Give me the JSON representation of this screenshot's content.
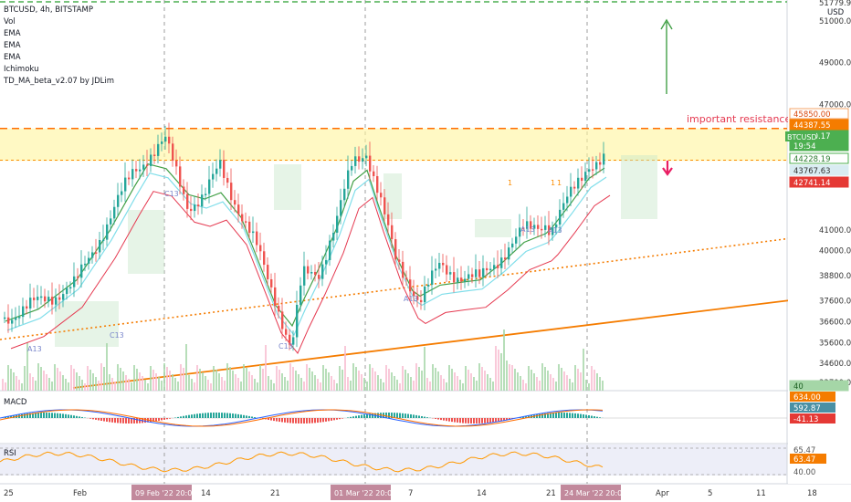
{
  "legend": {
    "title": "BTCUSD, 4h, BITSTAMP",
    "indicators": [
      "Vol",
      "EMA",
      "EMA",
      "EMA",
      "Ichimoku",
      "TD_MA_beta_v2.07 by JDLim"
    ]
  },
  "currency_label": "USD",
  "annotation": "important resistance",
  "symbol_tag": "BTCUSD",
  "macd_label": "MACD",
  "rsi_label": "RSI",
  "price_scale": {
    "ticks": [
      "51000.00",
      "49000.00",
      "47000.00",
      "41000.00",
      "40000.00",
      "38800.00",
      "37600.00",
      "36600.00",
      "35600.00",
      "34600.00",
      "33700.00"
    ],
    "top_partial": "51779.92",
    "badges": [
      {
        "text": "45850.00",
        "bg": "#ffffff",
        "fg": "#d9480f",
        "border": "#f4a46a"
      },
      {
        "text": "44387.55",
        "bg": "#f57c00",
        "fg": "#ffffff",
        "border": "#f57c00"
      },
      {
        "text": "44340.17",
        "bg": "#4caf50",
        "fg": "#ffffff",
        "border": "#4caf50"
      },
      {
        "text": "19:54",
        "bg": "#4caf50",
        "fg": "#ffffff",
        "border": "#4caf50"
      },
      {
        "text": "44228.19",
        "bg": "#ffffff",
        "fg": "#2e7d32",
        "border": "#4caf50"
      },
      {
        "text": "43767.63",
        "bg": "#d9ecf2",
        "fg": "#333333",
        "border": "#d9ecf2"
      },
      {
        "text": "42741.14",
        "bg": "#e53935",
        "fg": "#ffffff",
        "border": "#e53935"
      },
      {
        "text": "40",
        "bg": "#a5d6a7",
        "fg": "#1b5e20",
        "border": "#a5d6a7"
      }
    ],
    "macd_badges": [
      {
        "text": "634.00",
        "bg": "#f57c00",
        "fg": "#ffffff"
      },
      {
        "text": "592.87",
        "bg": "#4a90a4",
        "fg": "#ffffff"
      },
      {
        "text": "-41.13",
        "bg": "#e53935",
        "fg": "#ffffff"
      }
    ],
    "rsi_badges": [
      {
        "text": "65.47",
        "bg": "#ffffff",
        "fg": "#555555"
      },
      {
        "text": "63.47",
        "bg": "#f57c00",
        "fg": "#ffffff"
      },
      {
        "text": "40.00",
        "bg": "#ffffff",
        "fg": "#555555"
      }
    ]
  },
  "time_axis": {
    "labels": [
      "25",
      "Feb",
      "7",
      "14",
      "21",
      "7",
      "14",
      "21",
      "Apr",
      "5",
      "11",
      "18"
    ],
    "highlights": [
      "09 Feb '22  20:00",
      "01 Mar '22  20:00",
      "24 Mar '22  20:00"
    ]
  },
  "markers": {
    "td_labels": [
      "A13",
      "C13",
      "A13",
      "C13",
      "A13",
      "C13",
      "A13"
    ],
    "counts": [
      "1",
      "1",
      "1"
    ]
  },
  "colors": {
    "up": "#26a69a",
    "down": "#ef5350",
    "resistance_band": "#fff59d",
    "resistance_line": "#ff6d00",
    "trend_line": "#f57c00",
    "ema_fast": "#43a047",
    "ema_mid": "#80deea",
    "ema_slow": "#e53950",
    "arrow_up": "#43a047",
    "arrow_down": "#e91e63"
  },
  "chart_data": {
    "type": "candlestick",
    "symbol": "BTCUSD",
    "interval": "4h",
    "exchange": "BITSTAMP",
    "ylim": [
      33300,
      52000
    ],
    "x_dates": [
      "Jan 25",
      "Feb 1",
      "Feb 7",
      "Feb 14",
      "Feb 21",
      "Mar 1",
      "Mar 7",
      "Mar 14",
      "Mar 21",
      "Mar 24",
      "Apr 1",
      "Apr 5",
      "Apr 11",
      "Apr 18"
    ],
    "resistance": 45850,
    "last_price": 44340.17,
    "close_path": [
      {
        "date": "Jan 25",
        "close": 36800
      },
      {
        "date": "Jan 28",
        "close": 37500
      },
      {
        "date": "Feb 1",
        "close": 38400
      },
      {
        "date": "Feb 4",
        "close": 41500
      },
      {
        "date": "Feb 7",
        "close": 43800
      },
      {
        "date": "Feb 9",
        "close": 44500
      },
      {
        "date": "Feb 10",
        "close": 45200
      },
      {
        "date": "Feb 12",
        "close": 42200
      },
      {
        "date": "Feb 14",
        "close": 42500
      },
      {
        "date": "Feb 16",
        "close": 44100
      },
      {
        "date": "Feb 18",
        "close": 41800
      },
      {
        "date": "Feb 20",
        "close": 40100
      },
      {
        "date": "Feb 22",
        "close": 37800
      },
      {
        "date": "Feb 24",
        "close": 35200
      },
      {
        "date": "Feb 25",
        "close": 38800
      },
      {
        "date": "Feb 27",
        "close": 39000
      },
      {
        "date": "Feb 28",
        "close": 41500
      },
      {
        "date": "Mar 1",
        "close": 44200
      },
      {
        "date": "Mar 2",
        "close": 44800
      },
      {
        "date": "Mar 3",
        "close": 43000
      },
      {
        "date": "Mar 5",
        "close": 39500
      },
      {
        "date": "Mar 7",
        "close": 38300
      },
      {
        "date": "Mar 8",
        "close": 37600
      },
      {
        "date": "Mar 10",
        "close": 39200
      },
      {
        "date": "Mar 12",
        "close": 38800
      },
      {
        "date": "Mar 14",
        "close": 38600
      },
      {
        "date": "Mar 16",
        "close": 39800
      },
      {
        "date": "Mar 18",
        "close": 40900
      },
      {
        "date": "Mar 20",
        "close": 41400
      },
      {
        "date": "Mar 21",
        "close": 41000
      },
      {
        "date": "Mar 23",
        "close": 42500
      },
      {
        "date": "Mar 25",
        "close": 44200
      },
      {
        "date": "Mar 27",
        "close": 44340
      }
    ],
    "macd": {
      "macd": 634.0,
      "signal": 592.87,
      "histogram": -41.13
    },
    "rsi": {
      "value": 63.47,
      "upper": 65.47,
      "lower": 40.0
    }
  }
}
